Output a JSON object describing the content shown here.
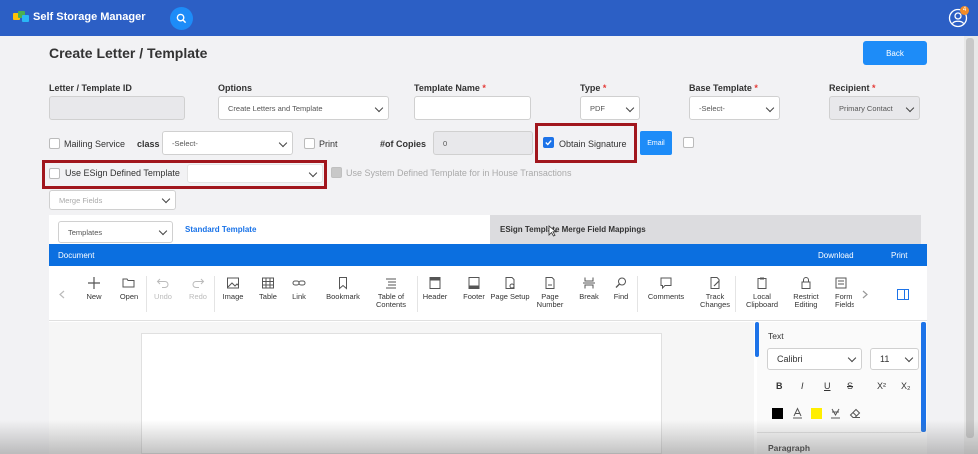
{
  "app": {
    "title": "Self Storage Manager",
    "notification_count": "4"
  },
  "page": {
    "title": "Create Letter / Template",
    "back_label": "Back"
  },
  "form": {
    "letter_id": {
      "label": "Letter / Template ID",
      "value": ""
    },
    "options": {
      "label": "Options",
      "value": "Create Letters and Template"
    },
    "template_name": {
      "label": "Template Name",
      "required": "*",
      "value": ""
    },
    "type": {
      "label": "Type",
      "required": "*",
      "value": "PDF"
    },
    "base_template": {
      "label": "Base Template",
      "required": "*",
      "value": "-Select-"
    },
    "recipient": {
      "label": "Recipient",
      "required": "*",
      "value": "Primary Contact"
    },
    "mailing_service": {
      "label": "Mailing Service",
      "checked": false
    },
    "class": {
      "label": "class",
      "value": "-Select-"
    },
    "print": {
      "label": "Print",
      "checked": false
    },
    "copies": {
      "label": "#of Copies",
      "value": "0"
    },
    "obtain_signature": {
      "label": "Obtain Signature",
      "checked": true
    },
    "email_label": "Email",
    "use_esign": {
      "label": "Use ESign Defined Template",
      "checked": false,
      "value": ""
    },
    "use_system": {
      "label": "Use System Defined Template for in House Transactions",
      "checked": false
    },
    "merge_fields": {
      "placeholder": "Merge Fields"
    }
  },
  "tabs": {
    "templates_select": "Templates",
    "standard": "Standard Template",
    "esign_mapping": "ESign Template Merge Field Mappings"
  },
  "editor": {
    "header": {
      "document": "Document",
      "download": "Download",
      "print": "Print"
    },
    "toolbar": [
      {
        "id": "new",
        "label": "New"
      },
      {
        "id": "open",
        "label": "Open"
      },
      {
        "id": "undo",
        "label": "Undo"
      },
      {
        "id": "redo",
        "label": "Redo"
      },
      {
        "id": "image",
        "label": "Image"
      },
      {
        "id": "table",
        "label": "Table"
      },
      {
        "id": "link",
        "label": "Link"
      },
      {
        "id": "bookmark",
        "label": "Bookmark"
      },
      {
        "id": "toc",
        "label": "Table of Contents"
      },
      {
        "id": "header",
        "label": "Header"
      },
      {
        "id": "footer",
        "label": "Footer"
      },
      {
        "id": "page-setup",
        "label": "Page Setup"
      },
      {
        "id": "page-number",
        "label": "Page Number"
      },
      {
        "id": "break",
        "label": "Break"
      },
      {
        "id": "find",
        "label": "Find"
      },
      {
        "id": "comments",
        "label": "Comments"
      },
      {
        "id": "track-changes",
        "label": "Track Changes"
      },
      {
        "id": "local-clipboard",
        "label": "Local Clipboard"
      },
      {
        "id": "restrict-editing",
        "label": "Restrict Editing"
      },
      {
        "id": "form-fields",
        "label": "Form Fields"
      }
    ],
    "text_pane": {
      "section": "Text",
      "font": "Calibri",
      "size": "11",
      "bold": "B",
      "italic": "I",
      "underline": "U",
      "strike": "S",
      "superscript": "X²",
      "subscript": "X₂",
      "paragraph": "Paragraph",
      "font_color": "#000000",
      "highlight_color": "#ffee00"
    }
  },
  "colors": {
    "topbar": "#2c5fc5",
    "primary": "#1d8cf8",
    "highlight_box": "#a1161d"
  }
}
